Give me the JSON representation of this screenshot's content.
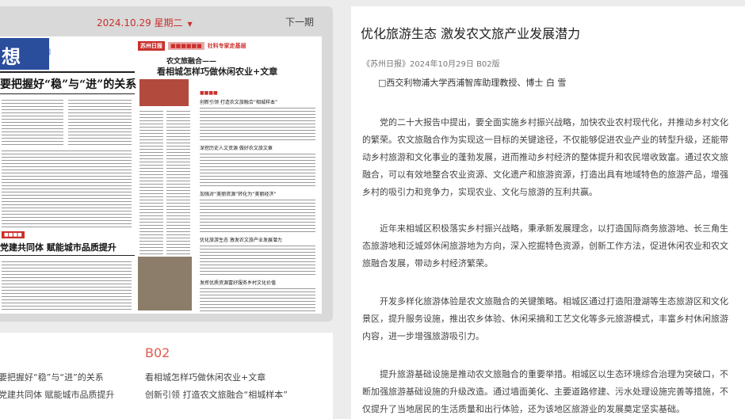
{
  "nav": {
    "date": "2024.10.29 星期二",
    "next_page": "下一期"
  },
  "paper": {
    "masthead": "想",
    "monthly": "月刊",
    "left_head1": "要把握好“稳”与“进”的关系",
    "left_head2": "党建共同体 赋能城市品质提升",
    "banner_brand": "苏州日报",
    "banner_text": "社科专家走基层",
    "subtitle": "农文旅融合——",
    "headline": "看相城怎样巧做休闲农业+文章",
    "small_heads": [
      "创新引领 打造农文旅融合“相城样本”",
      "深挖历史人文资源 做好农文旅文章",
      "加强对“美丽资源”转化为“美丽经济”",
      "优化旅游生态 激发农文旅产业发展潜力",
      "发挥优质资源富好服务乡村文化价值"
    ]
  },
  "edition": {
    "code": "B02",
    "left_items": [
      "要把握好“稳”与“进”的关系",
      "党建共同体 赋能城市品质提升"
    ],
    "right_items": [
      "看相城怎样巧做休闲农业+文章",
      "创新引领 打造农文旅融合“相城样本”"
    ]
  },
  "article": {
    "title": "优化旅游生态 激发农文旅产业发展潜力",
    "meta": "《苏州日报》2024年10月29日 B02版",
    "author": "□西交利物浦大学西浦智库助理教授、博士 白 雪",
    "paragraphs": [
      "党的二十大报告中提出，要全面实施乡村振兴战略，加快农业农村现代化，并推动乡村文化的繁荣。农文旅融合作为实现这一目标的关键途径，不仅能够促进农业产业的转型升级，还能带动乡村旅游和文化事业的蓬勃发展，进而推动乡村经济的整体提升和农民增收致富。通过农文旅融合，可以有效地整合农业资源、文化遗产和旅游资源，打造出具有地域特色的旅游产品，增强乡村的吸引力和竞争力，实现农业、文化与旅游的互利共赢。",
      "近年来相城区积极落实乡村振兴战略，秉承新发展理念，以打造国际商务旅游地、长三角生态旅游地和泛城郊休闲旅游地为方向，深入挖掘特色资源，创新工作方法，促进休闲农业和农文旅融合发展，带动乡村经济繁荣。",
      "开发多样化旅游体验是农文旅融合的关键策略。相城区通过打造阳澄湖等生态旅游区和文化景区，提升服务设施，推出农乡体验、休闲采摘和工艺文化等多元旅游模式，丰富乡村休闲旅游内容，进一步增强旅游吸引力。",
      "提升旅游基础设施是推动农文旅融合的重要举措。相城区以生态环境综合治理为突破口，不断加强旅游基础设施的升级改造。通过墙面美化、主要道路修建、污水处理设施完善等措施，不仅提升了当地居民的生活质量和出行体验，还为该地区旅游业的发展奠定坚实基础。"
    ]
  },
  "colors": {
    "accent": "#c9302c",
    "edition": "#e05a4c",
    "masthead_blue": "#2a4d9c"
  }
}
